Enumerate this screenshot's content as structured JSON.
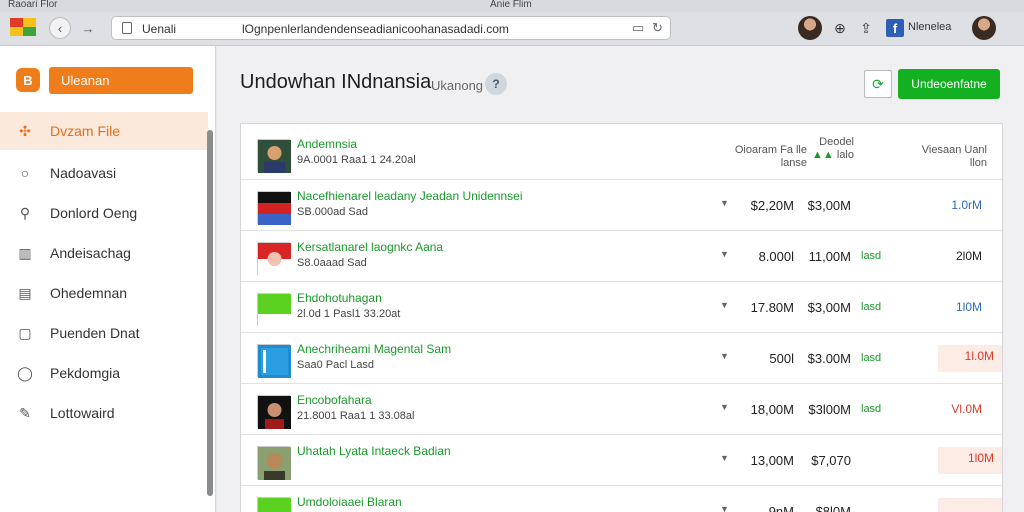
{
  "window": {
    "left_title": "Raoari Flor",
    "center_title": "Anie Flim"
  },
  "toolbar": {
    "url_title": "Uenali",
    "url": "lOgnpenlerlandendenseadianicoohanasadadi.com",
    "profile_name": "Nlenelea"
  },
  "sidebar": {
    "badge": "B",
    "primary_button": "Uleanan",
    "items": [
      {
        "label": "Dvzam File",
        "icon": "tag-icon",
        "active": true
      },
      {
        "label": "Nadoavasi",
        "icon": "circle-icon",
        "active": false
      },
      {
        "label": "Donlord Oeng",
        "icon": "search-icon",
        "active": false
      },
      {
        "label": "Andeisachag",
        "icon": "chart-icon",
        "active": false
      },
      {
        "label": "Ohedemnan",
        "icon": "document-icon",
        "active": false
      },
      {
        "label": "Puenden Dnat",
        "icon": "frame-icon",
        "active": false
      },
      {
        "label": "Pekdomgia",
        "icon": "bubble-icon",
        "active": false
      },
      {
        "label": "Lottowaird",
        "icon": "pencil-icon",
        "active": false
      }
    ]
  },
  "main": {
    "title": "Undowhan INdnansia",
    "subtitle": "Ukanong",
    "help": "?",
    "download_button": "Undeoenfatne"
  },
  "table": {
    "headers": {
      "col1_line1": "Oioaram Fa lle",
      "col1_line2": "lanse",
      "col2_line1": "Deodel",
      "col2_line2": "lalo",
      "col3_line1": "Viesaan Uanl",
      "col3_line2": "llon"
    },
    "rows": [
      {
        "title": "Andemnsia",
        "sub": "9A.0001 Raa1 1 24.20al",
        "arrow": "",
        "c1": "",
        "c2": "",
        "trend": "",
        "c3": "",
        "c3_color": "#2d6fb5",
        "hl": false,
        "thumb": "portrait"
      },
      {
        "title": "Nacefhienarel leadany Jeadan Unidennsei",
        "sub": "SB.000ad Sad",
        "arrow": "▼",
        "c1": "$2,20M",
        "c2": "$3,00M",
        "trend": "",
        "c3": "1.0rM",
        "c3_color": "#2d6fb5",
        "hl": false,
        "thumb": "flag-german"
      },
      {
        "title": "Kersatlanarel laognkc Aana",
        "sub": "S8.0aaad Sad",
        "arrow": "▼",
        "c1": "8.000l",
        "c2": "11,00M",
        "trend": "lasd",
        "c3": "2l0M",
        "c3_color": "#222222",
        "hl": false,
        "thumb": "flag-indonesia"
      },
      {
        "title": "Ehdohotuhagan",
        "sub": "2l.0d 1 Pasl1 33.20at",
        "arrow": "▼",
        "c1": "17.80M",
        "c2": "$3,00M",
        "trend": "lasd",
        "c3": "1l0M",
        "c3_color": "#2d6fb5",
        "hl": false,
        "thumb": "green-box"
      },
      {
        "title": "Anechriheami Magental Sam",
        "sub": "Saa0 Pacl Lasd",
        "arrow": "▼",
        "c1": "500l",
        "c2": "$3.00M",
        "trend": "lasd",
        "c3": "1l.0M",
        "c3_color": "#e03a2a",
        "hl": true,
        "thumb": "book-blue"
      },
      {
        "title": "Encobofahara",
        "sub": "21.8001 Raa1 1 33.08al",
        "arrow": "▼",
        "c1": "18,00M",
        "c2": "$3l00M",
        "trend": "lasd",
        "c3": "Vl.0M",
        "c3_color": "#e03a2a",
        "hl": false,
        "thumb": "portrait-dark"
      },
      {
        "title": "Uhatah Lyata Intaeck Badian",
        "sub": "",
        "arrow": "▼",
        "c1": "13,00M",
        "c2": "$7,070",
        "trend": "",
        "c3": "1l0M",
        "c3_color": "#e03a2a",
        "hl": true,
        "thumb": "portrait-man"
      },
      {
        "title": "Umdoloiaaei Blaran",
        "sub": "",
        "arrow": "▼",
        "c1": "9nM",
        "c2": "$8l0M",
        "trend": "",
        "c3": "",
        "c3_color": "#e03a2a",
        "hl": true,
        "thumb": "green-box"
      }
    ]
  }
}
